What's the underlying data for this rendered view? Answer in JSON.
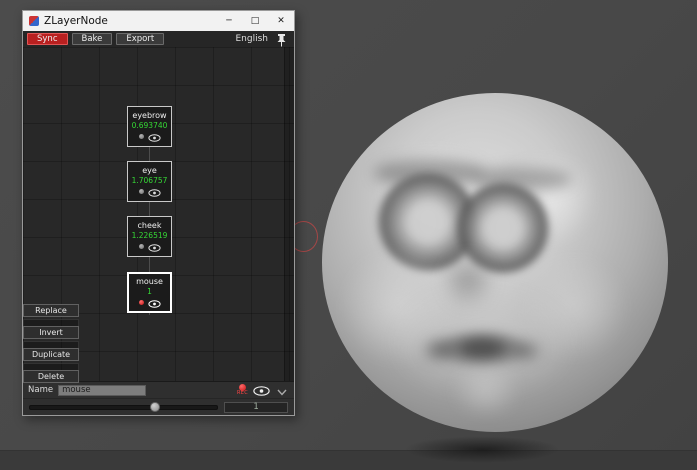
{
  "window": {
    "title": "ZLayerNode",
    "controls": {
      "minimize": "─",
      "maximize": "□",
      "close": "✕"
    }
  },
  "toolbar": {
    "sync": "Sync",
    "bake": "Bake",
    "export": "Export",
    "language": "English"
  },
  "nodes": [
    {
      "name": "eyebrow",
      "value": "0.693740"
    },
    {
      "name": "eye",
      "value": "1.706757"
    },
    {
      "name": "cheek",
      "value": "1.226519"
    },
    {
      "name": "mouse",
      "value": "1"
    }
  ],
  "side_buttons": [
    "Replace",
    "Invert",
    "Duplicate",
    "Delete"
  ],
  "footer": {
    "name_label": "Name",
    "name_value": "mouse",
    "rec_label": "REC",
    "slider_value": "1"
  },
  "colors": {
    "value_green": "#35d835",
    "rec_red": "#c51212",
    "sync_red": "#b92020",
    "selection_white": "#ffffff"
  },
  "icons": [
    "app-icon",
    "pin-icon",
    "layer-ball-icon",
    "eye-icon",
    "rec-icon",
    "chevron-down-icon"
  ]
}
